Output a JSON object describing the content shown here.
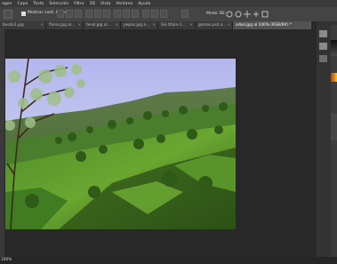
{
  "menu": [
    "agen",
    "Capa",
    "Texto",
    "Selección",
    "Filtro",
    "3D",
    "Vista",
    "Ventana",
    "Ayuda"
  ],
  "options": {
    "auto_select_label": "Mostrar cont. transf.",
    "mode_3d_label": "Modo 3D:"
  },
  "tabs": [
    {
      "label": "bosdo1.jpg",
      "active": false
    },
    {
      "label": "flores.jpg al...",
      "active": false
    },
    {
      "label": "tesol.jpg al...",
      "active": false
    },
    {
      "label": "pepas.jpg a...",
      "active": false
    },
    {
      "label": "Sin título-1...",
      "active": false
    },
    {
      "label": "gamos.psd a...",
      "active": false
    },
    {
      "label": "arbol.jpg al 100% (RGB/8#) *",
      "active": true
    }
  ],
  "status": {
    "zoom": "100%",
    "doc": "Doc: 4,16..."
  },
  "colors": {
    "chrome": "#3a3a3a",
    "workspace": "#282828",
    "active_tab": "#525252",
    "accent_swatch": "#c0392b"
  }
}
